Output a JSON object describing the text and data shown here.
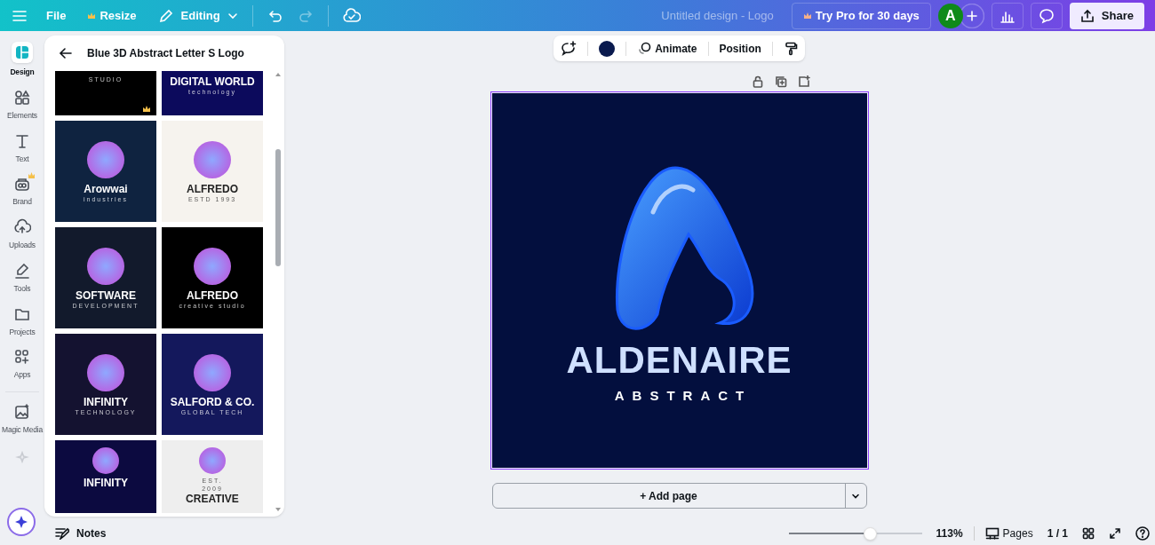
{
  "topbar": {
    "menu": "File",
    "resize": "Resize",
    "mode": "Editing",
    "title": "Untitled design - Logo",
    "try_pro": "Try Pro for 30 days",
    "avatar": "A",
    "share": "Share"
  },
  "rail": [
    {
      "label": "Design",
      "kind": "design",
      "selected": true
    },
    {
      "label": "Elements",
      "kind": "elements",
      "selected": false
    },
    {
      "label": "Text",
      "kind": "text",
      "selected": false
    },
    {
      "label": "Brand",
      "kind": "brand",
      "selected": false
    },
    {
      "label": "Uploads",
      "kind": "uploads",
      "selected": false
    },
    {
      "label": "Tools",
      "kind": "tools",
      "selected": false
    },
    {
      "label": "Projects",
      "kind": "projects",
      "selected": false
    },
    {
      "label": "Apps",
      "kind": "apps",
      "selected": false
    },
    {
      "label": "Magic Media",
      "kind": "magic",
      "selected": false
    }
  ],
  "panel": {
    "title": "Blue 3D Abstract Letter S Logo",
    "templates": [
      {
        "kind": "top-cut",
        "color": "#000000",
        "lines": [
          {
            "kind": "small",
            "text": "STUDIO"
          }
        ],
        "pro": true
      },
      {
        "kind": "top-cut",
        "color": "#0c0a5c",
        "lines": [
          {
            "kind": "big",
            "text": "DIGITAL WORLD"
          },
          {
            "kind": "small",
            "text": "technology"
          }
        ]
      },
      {
        "kind": "full",
        "color": "#0f2340",
        "lines": [
          {
            "kind": "big",
            "text": "Arowwai"
          },
          {
            "kind": "small",
            "text": "industries"
          }
        ]
      },
      {
        "kind": "full",
        "color": "#f6f3ee",
        "lines": [
          {
            "kind": "big",
            "text": "ALFREDO"
          },
          {
            "kind": "small",
            "text": "ESTD 1993"
          }
        ]
      },
      {
        "kind": "full",
        "color": "#121a2c",
        "lines": [
          {
            "kind": "big",
            "text": "SOFTWARE"
          },
          {
            "kind": "small",
            "text": "DEVELOPMENT"
          }
        ]
      },
      {
        "kind": "full",
        "color": "#000000",
        "lines": [
          {
            "kind": "big",
            "text": "ALFREDO"
          },
          {
            "kind": "small",
            "text": "creative studio"
          }
        ]
      },
      {
        "kind": "full",
        "color": "#141230",
        "lines": [
          {
            "kind": "big",
            "text": "INFINITY"
          },
          {
            "kind": "small",
            "text": "TECHNOLOGY"
          }
        ]
      },
      {
        "kind": "full",
        "color": "#14185c",
        "lines": [
          {
            "kind": "big",
            "text": "SALFORD & CO."
          },
          {
            "kind": "small",
            "text": "GLOBAL TECH"
          }
        ]
      },
      {
        "kind": "bottom-cut",
        "color": "#0c0a40",
        "lines": [
          {
            "kind": "big",
            "text": "INFINITY"
          }
        ]
      },
      {
        "kind": "bottom-cut",
        "color": "#eeeeee",
        "lines": [
          {
            "kind": "small",
            "text": "EST."
          },
          {
            "kind": "small",
            "text": "2009"
          },
          {
            "kind": "big",
            "text": "CREATIVE"
          }
        ]
      }
    ]
  },
  "toolbar": {
    "color": "#0a1a4e",
    "animate": "Animate",
    "position": "Position"
  },
  "design": {
    "name": "ALDENAIRE",
    "tagline": "ABSTRACT"
  },
  "add_page": "+ Add page",
  "footer": {
    "notes": "Notes",
    "zoom": {
      "level": 0.61,
      "reading": "113%"
    },
    "pages": "Pages",
    "page_count": "1 / 1"
  }
}
